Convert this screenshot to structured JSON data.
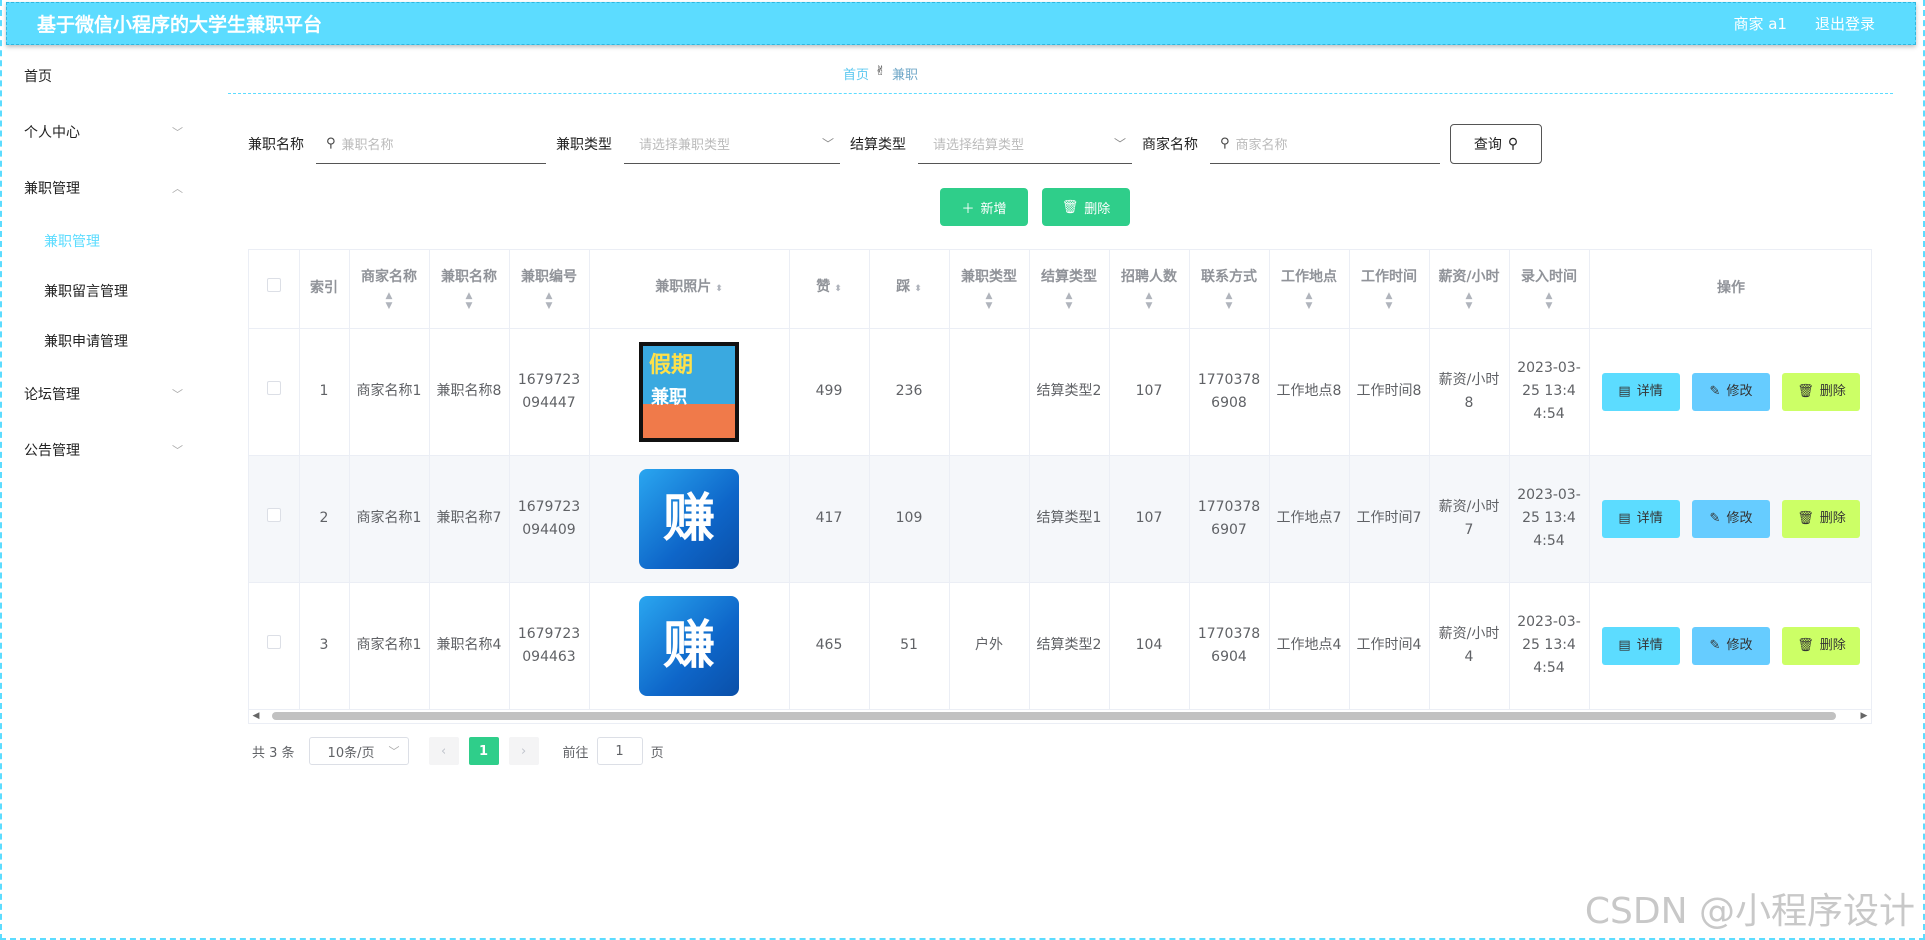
{
  "header": {
    "app_title": "基于微信小程序的大学生兼职平台",
    "user_label": "商家 a1",
    "logout_label": "退出登录"
  },
  "sidebar": {
    "home": "首页",
    "personal": "个人中心",
    "job_mgmt": "兼职管理",
    "job_mgmt_sub": [
      "兼职管理",
      "兼职留言管理",
      "兼职申请管理"
    ],
    "forum": "论坛管理",
    "notice": "公告管理"
  },
  "breadcrumb": {
    "home": "首页",
    "current": "兼职"
  },
  "search": {
    "name_label": "兼职名称",
    "name_placeholder": "兼职名称",
    "type_label": "兼职类型",
    "type_placeholder": "请选择兼职类型",
    "settle_label": "结算类型",
    "settle_placeholder": "请选择结算类型",
    "merchant_label": "商家名称",
    "merchant_placeholder": "商家名称",
    "query_button": "查询"
  },
  "actions": {
    "add": "新增",
    "delete": "删除"
  },
  "table": {
    "headers": [
      "索引",
      "商家名称",
      "兼职名称",
      "兼职编号",
      "兼职照片",
      "赞",
      "踩",
      "兼职类型",
      "结算类型",
      "招聘人数",
      "联系方式",
      "工作地点",
      "工作时间",
      "薪资/小时",
      "录入时间",
      "操作"
    ],
    "rows": [
      {
        "index": "1",
        "merchant": "商家名称1",
        "name": "兼职名称8",
        "code": "1679723094447",
        "photo": "poster",
        "likes": "499",
        "dislikes": "236",
        "type": "",
        "settle": "结算类型2",
        "count": "107",
        "contact": "17703786908",
        "place": "工作地点8",
        "time": "工作时间8",
        "salary": "薪资/小时8",
        "created": "2023-03-25 13:44:54"
      },
      {
        "index": "2",
        "merchant": "商家名称1",
        "name": "兼职名称7",
        "code": "1679723094409",
        "photo": "赚",
        "likes": "417",
        "dislikes": "109",
        "type": "",
        "settle": "结算类型1",
        "count": "107",
        "contact": "17703786907",
        "place": "工作地点7",
        "time": "工作时间7",
        "salary": "薪资/小时7",
        "created": "2023-03-25 13:44:54"
      },
      {
        "index": "3",
        "merchant": "商家名称1",
        "name": "兼职名称4",
        "code": "1679723094463",
        "photo": "赚",
        "likes": "465",
        "dislikes": "51",
        "type": "户外",
        "settle": "结算类型2",
        "count": "104",
        "contact": "17703786904",
        "place": "工作地点4",
        "time": "工作时间4",
        "salary": "薪资/小时4",
        "created": "2023-03-25 13:44:54"
      }
    ],
    "op_labels": {
      "detail": "详情",
      "edit": "修改",
      "delete": "删除"
    },
    "poster_text": [
      "假期",
      "兼职"
    ]
  },
  "pagination": {
    "total": "共 3 条",
    "page_size": "10条/页",
    "current_page": "1",
    "goto_label": "前往",
    "goto_value": "1",
    "page_suffix": "页"
  },
  "watermark": "CSDN @小程序设计",
  "colors": {
    "primary": "#5cdcff",
    "green": "#2fce8a",
    "edit": "#66ccff",
    "delete": "#ccff66"
  }
}
